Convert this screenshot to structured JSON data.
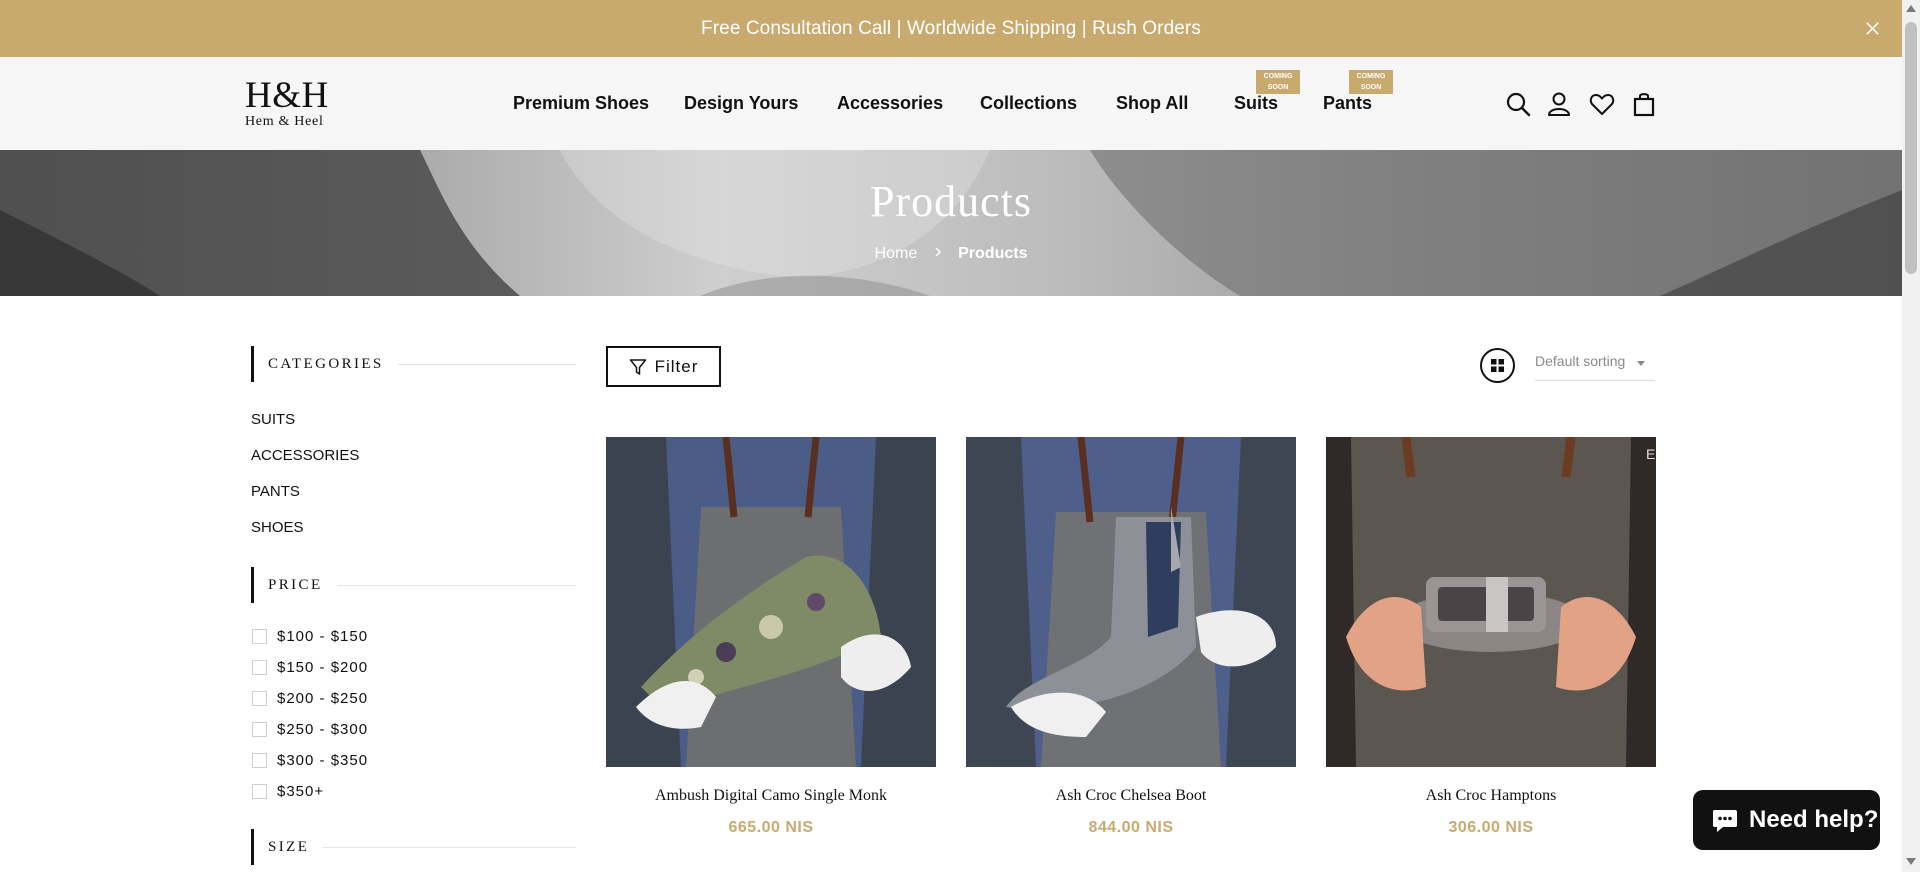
{
  "announcement": {
    "text": "Free Consultation Call | Worldwide Shipping | Rush Orders"
  },
  "header": {
    "logo_mark": "H&H",
    "logo_sub": "Hem & Heel",
    "nav": [
      {
        "label": "Premium Shoes"
      },
      {
        "label": "Design Yours"
      },
      {
        "label": "Accessories"
      },
      {
        "label": "Collections"
      },
      {
        "label": "Shop All"
      },
      {
        "label": "Suits",
        "badge": [
          "COMING",
          "SOON"
        ]
      },
      {
        "label": "Pants",
        "badge": [
          "COMING",
          "SOON"
        ]
      }
    ],
    "icons": [
      "search-icon",
      "account-icon",
      "wishlist-heart-icon",
      "cart-bag-icon"
    ]
  },
  "hero": {
    "title": "Products",
    "breadcrumb": {
      "home": "Home",
      "current": "Products"
    }
  },
  "sidebar": {
    "categories_title": "CATEGORIES",
    "categories": [
      "SUITS",
      "ACCESSORIES",
      "PANTS",
      "SHOES"
    ],
    "price_title": "PRICE",
    "prices": [
      "$100 - $150",
      "$150 - $200",
      "$200 - $250",
      "$250 - $300",
      "$300 - $350",
      "$350+"
    ],
    "size_title": "SIZE"
  },
  "toolbar": {
    "filter_label": "Filter",
    "sort_value": "Default sorting",
    "grid_icon": "grid-view-icon"
  },
  "products": [
    {
      "name": "Ambush Digital Camo Single Monk",
      "price": "665.00 NIS"
    },
    {
      "name": "Ash Croc Chelsea Boot",
      "price": "844.00 NIS"
    },
    {
      "name": "Ash Croc Hamptons",
      "price": "306.00 NIS"
    }
  ],
  "help": {
    "label": "Need help?",
    "icon": "chat-bubble-icon"
  },
  "colors": {
    "accent_gold": "#c8aa6e",
    "text": "#111111",
    "header_bg": "#f6f6f6"
  }
}
